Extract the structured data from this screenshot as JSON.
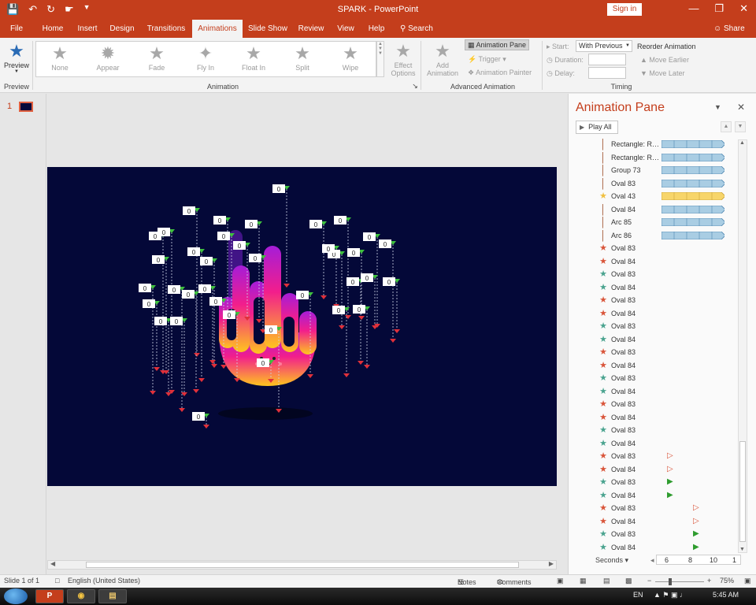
{
  "app": {
    "title": "SPARK  -  PowerPoint",
    "sign_in": "Sign in",
    "qat": [
      "save-icon",
      "undo-icon",
      "redo-icon",
      "touch-mode-icon",
      "customize-icon"
    ],
    "window_buttons": [
      "minimize-icon",
      "restore-icon",
      "close-icon"
    ]
  },
  "tabs": [
    {
      "label": "File"
    },
    {
      "label": "Home"
    },
    {
      "label": "Insert"
    },
    {
      "label": "Design"
    },
    {
      "label": "Transitions"
    },
    {
      "label": "Animations"
    },
    {
      "label": "Slide Show"
    },
    {
      "label": "Review"
    },
    {
      "label": "View"
    },
    {
      "label": "Help"
    }
  ],
  "active_tab": "Animations",
  "search_label": "Search",
  "share_label": "Share",
  "ribbon": {
    "preview": {
      "label": "Preview",
      "group": "Preview"
    },
    "animation_gallery": [
      "None",
      "Appear",
      "Fade",
      "Fly In",
      "Float In",
      "Split",
      "Wipe"
    ],
    "animation_group": "Animation",
    "effect_options": "Effect Options",
    "add_animation": "Add Animation",
    "animation_pane": "Animation Pane",
    "trigger": "Trigger",
    "animation_painter": "Animation Painter",
    "advanced_group": "Advanced Animation",
    "start_label": "Start:",
    "start_value": "With Previous",
    "duration_label": "Duration:",
    "delay_label": "Delay:",
    "reorder_title": "Reorder Animation",
    "move_earlier": "Move Earlier",
    "move_later": "Move Later",
    "timing_group": "Timing"
  },
  "slide_panel": {
    "number": "1"
  },
  "slide": {
    "background": "#040838",
    "trigger_labels": [
      "0",
      "0",
      "0",
      "0",
      "0",
      "0",
      "0",
      "0",
      "0",
      "0",
      "0",
      "0",
      "0",
      "0",
      "0",
      "0",
      "0",
      "0",
      "0",
      "0",
      "0",
      "0",
      "0",
      "0",
      "0",
      "0",
      "0",
      "0",
      "0",
      "0",
      "0",
      "0",
      "0",
      "0",
      "0",
      "0",
      "0"
    ]
  },
  "animation_pane": {
    "title": "Animation Pane",
    "play_all": "Play All",
    "items": [
      {
        "label": "Rectangle: Ro...",
        "type": "motion",
        "bar": "blue"
      },
      {
        "label": "Rectangle: Ro...",
        "type": "motion",
        "bar": "blue"
      },
      {
        "label": "Group 73",
        "type": "motion",
        "bar": "blue"
      },
      {
        "label": "Oval 83",
        "type": "motion",
        "bar": "blue"
      },
      {
        "label": "Oval 43",
        "type": "emphasis",
        "bar": "yellow"
      },
      {
        "label": "Oval 84",
        "type": "motion",
        "bar": "blue"
      },
      {
        "label": "Arc 85",
        "type": "motion",
        "bar": "blue"
      },
      {
        "label": "Arc 86",
        "type": "motion",
        "bar": "blue"
      },
      {
        "label": "Oval 83",
        "type": "exit"
      },
      {
        "label": "Oval 84",
        "type": "exit"
      },
      {
        "label": "Oval 83",
        "type": "entrance"
      },
      {
        "label": "Oval 84",
        "type": "entrance"
      },
      {
        "label": "Oval 83",
        "type": "exit"
      },
      {
        "label": "Oval 84",
        "type": "exit"
      },
      {
        "label": "Oval 83",
        "type": "entrance"
      },
      {
        "label": "Oval 84",
        "type": "entrance"
      },
      {
        "label": "Oval 83",
        "type": "exit"
      },
      {
        "label": "Oval 84",
        "type": "exit"
      },
      {
        "label": "Oval 83",
        "type": "entrance"
      },
      {
        "label": "Oval 84",
        "type": "entrance"
      },
      {
        "label": "Oval 83",
        "type": "exit"
      },
      {
        "label": "Oval 84",
        "type": "exit"
      },
      {
        "label": "Oval 83",
        "type": "entrance"
      },
      {
        "label": "Oval 84",
        "type": "entrance"
      },
      {
        "label": "Oval 83",
        "type": "exit",
        "marker": "red",
        "pos": 0
      },
      {
        "label": "Oval 84",
        "type": "exit",
        "marker": "red",
        "pos": 0
      },
      {
        "label": "Oval 83",
        "type": "entrance",
        "marker": "green",
        "pos": 0
      },
      {
        "label": "Oval 84",
        "type": "entrance",
        "marker": "green",
        "pos": 0
      },
      {
        "label": "Oval 83",
        "type": "exit",
        "marker": "red",
        "pos": 1
      },
      {
        "label": "Oval 84",
        "type": "exit",
        "marker": "red",
        "pos": 1
      },
      {
        "label": "Oval 83",
        "type": "entrance",
        "marker": "green",
        "pos": 1
      },
      {
        "label": "Oval 84",
        "type": "entrance",
        "marker": "green",
        "pos": 1
      }
    ],
    "seconds_label": "Seconds",
    "ruler": [
      "6",
      "8",
      "10",
      "1"
    ]
  },
  "status": {
    "slide": "Slide 1 of 1",
    "language": "English (United States)",
    "notes": "Notes",
    "comments": "Comments",
    "zoom": "75%"
  },
  "taskbar": {
    "lang": "EN",
    "time": "5:45 AM"
  },
  "colors": {
    "accent": "#c43e1c",
    "bar_blue": "#a9cde3",
    "bar_yellow": "#f7d56a",
    "entrance": "#4aa38f",
    "exit": "#d9553a"
  }
}
